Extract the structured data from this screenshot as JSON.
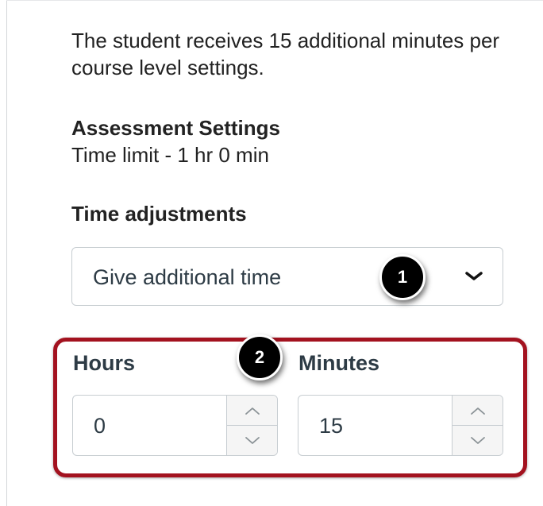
{
  "info": {
    "text": "The student receives 15 additional minutes per course level settings."
  },
  "assessment_settings": {
    "heading": "Assessment Settings",
    "time_limit": "Time limit - 1 hr 0 min"
  },
  "time_adjustments": {
    "label": "Time adjustments",
    "selected_option": "Give additional time",
    "icon": "chevron-down-icon"
  },
  "fields": {
    "hours_label": "Hours",
    "hours_value": "0",
    "minutes_label": "Minutes",
    "minutes_value": "15",
    "stepper_up_icon": "chevron-up-icon",
    "stepper_down_icon": "chevron-down-icon"
  },
  "callouts": {
    "badge_1": "1",
    "badge_2": "2",
    "highlight_color": "#a3121f"
  }
}
